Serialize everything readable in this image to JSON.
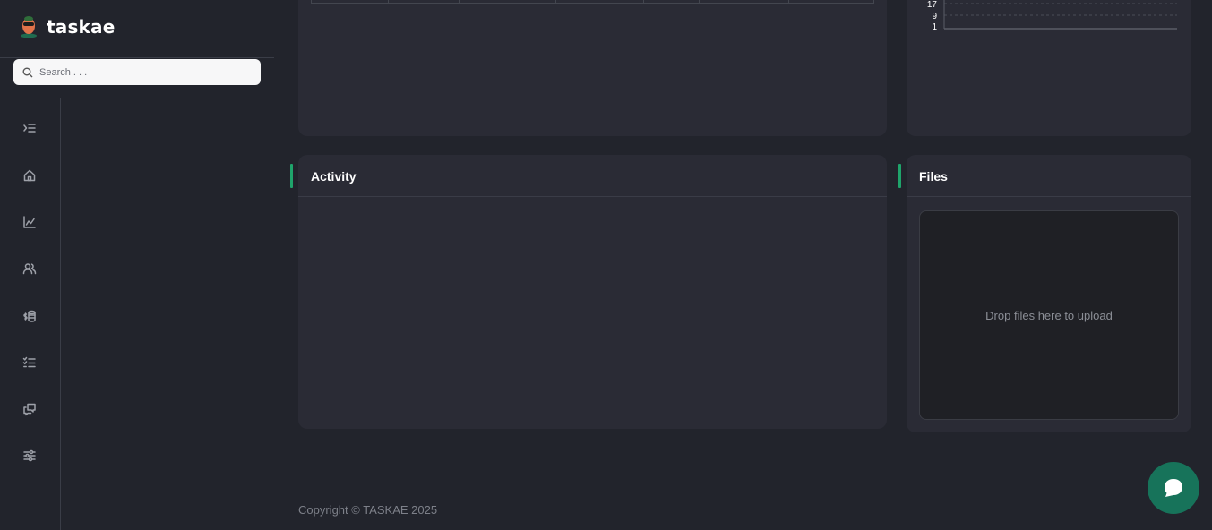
{
  "app": {
    "name": "taskae"
  },
  "search": {
    "placeholder": "Search . . ."
  },
  "sidebar": {
    "icons": [
      "collapse-menu-icon",
      "home-icon",
      "analytics-icon",
      "users-icon",
      "finance-icon",
      "tasks-icon",
      "messages-icon",
      "settings-sliders-icon"
    ]
  },
  "chart_data": {
    "type": "line",
    "ytick_labels": [
      "17",
      "9",
      "1"
    ],
    "grid": true
  },
  "activity": {
    "title": "Activity"
  },
  "files": {
    "title": "Files",
    "dropzone_text": "Drop files here to upload"
  },
  "footer": {
    "copyright": "Copyright © TASKAE 2025"
  },
  "colors": {
    "accent": "#1fa46b",
    "fab": "#17735a",
    "background": "#22242c",
    "card": "#2a2b35"
  }
}
